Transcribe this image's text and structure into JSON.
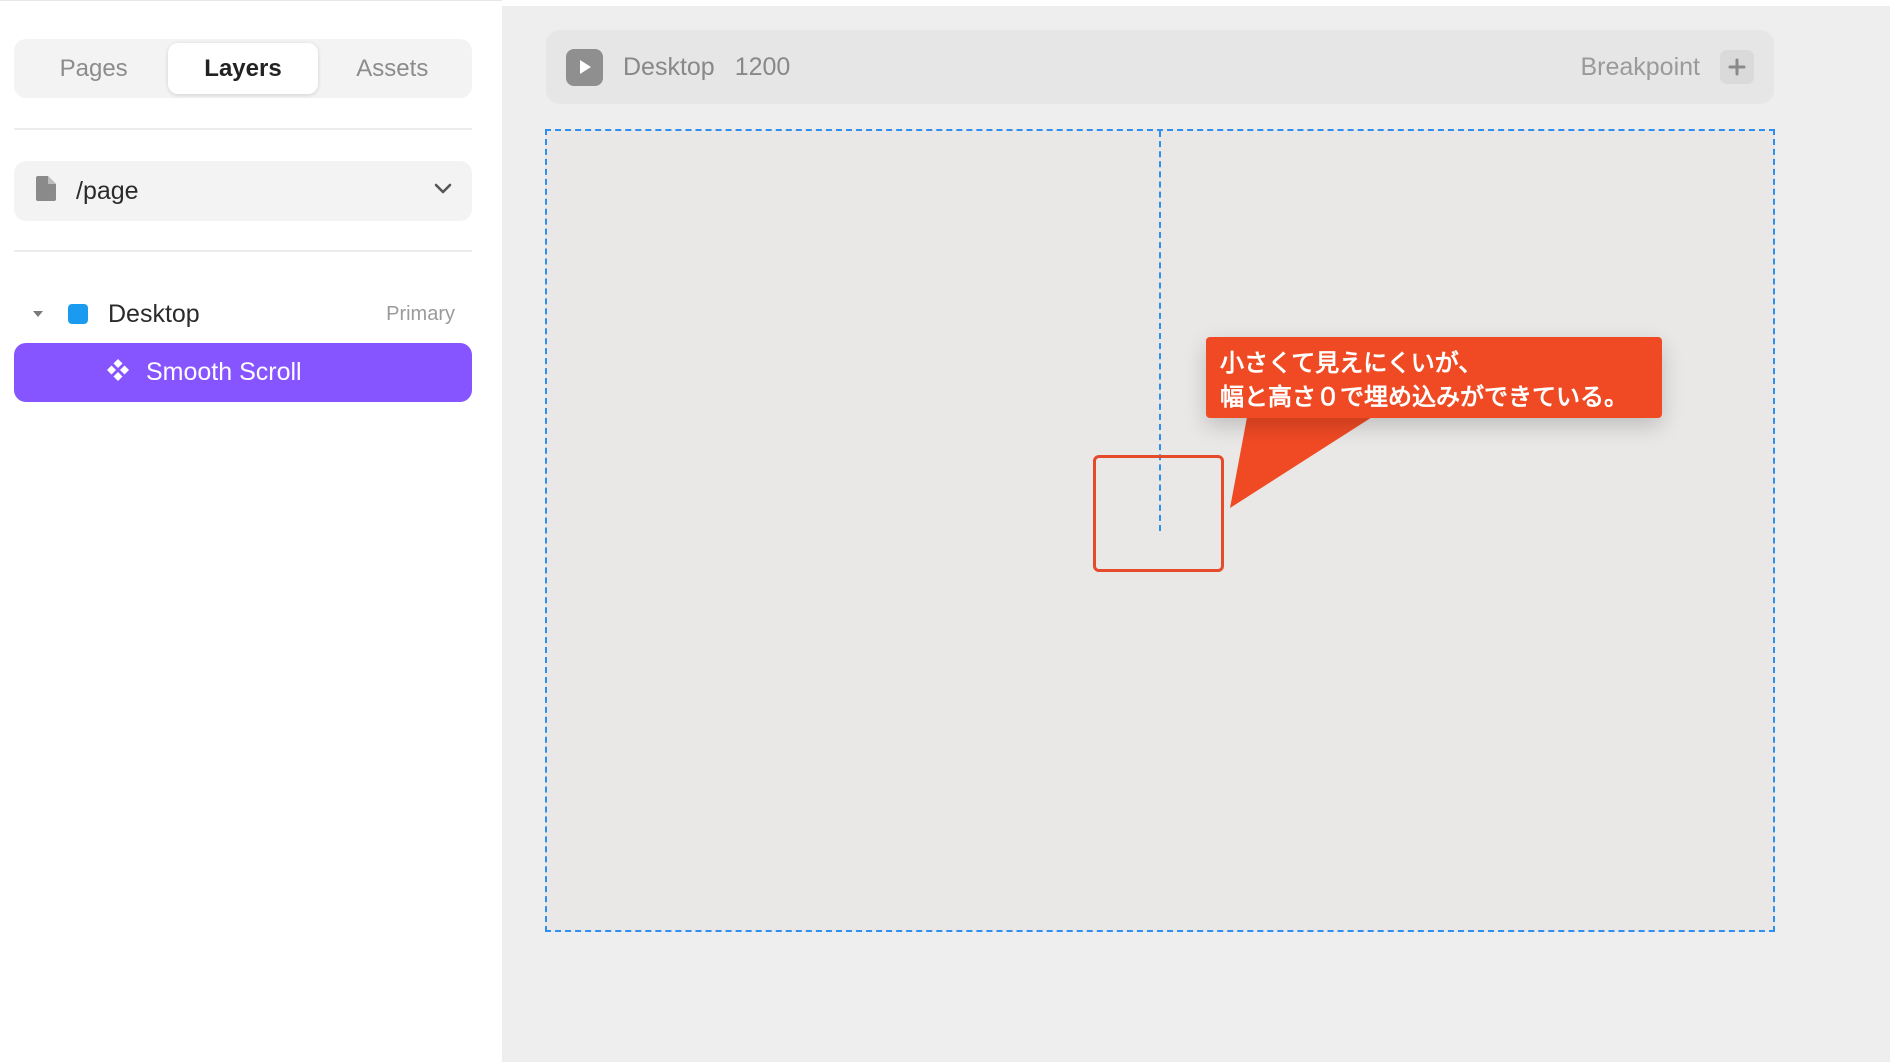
{
  "sidebar": {
    "tabs": [
      {
        "label": "Pages",
        "active": false
      },
      {
        "label": "Layers",
        "active": true
      },
      {
        "label": "Assets",
        "active": false
      }
    ],
    "page_select": {
      "value": "/page",
      "icon": "file-icon"
    },
    "layers": [
      {
        "name": "Desktop",
        "tag": "Primary",
        "color": "#1a9bf0",
        "expanded": true
      },
      {
        "name": "Smooth Scroll",
        "selected": true,
        "icon": "component-icon",
        "color": "#8755ff"
      }
    ]
  },
  "canvas": {
    "breakpoint_bar": {
      "name": "Desktop",
      "width": "1200",
      "breakpoint_label": "Breakpoint"
    },
    "annotation": {
      "line1": "小さくて見えにくいが、",
      "line2": "幅と高さ０で埋め込みができている。",
      "color": "#f04a24"
    }
  }
}
